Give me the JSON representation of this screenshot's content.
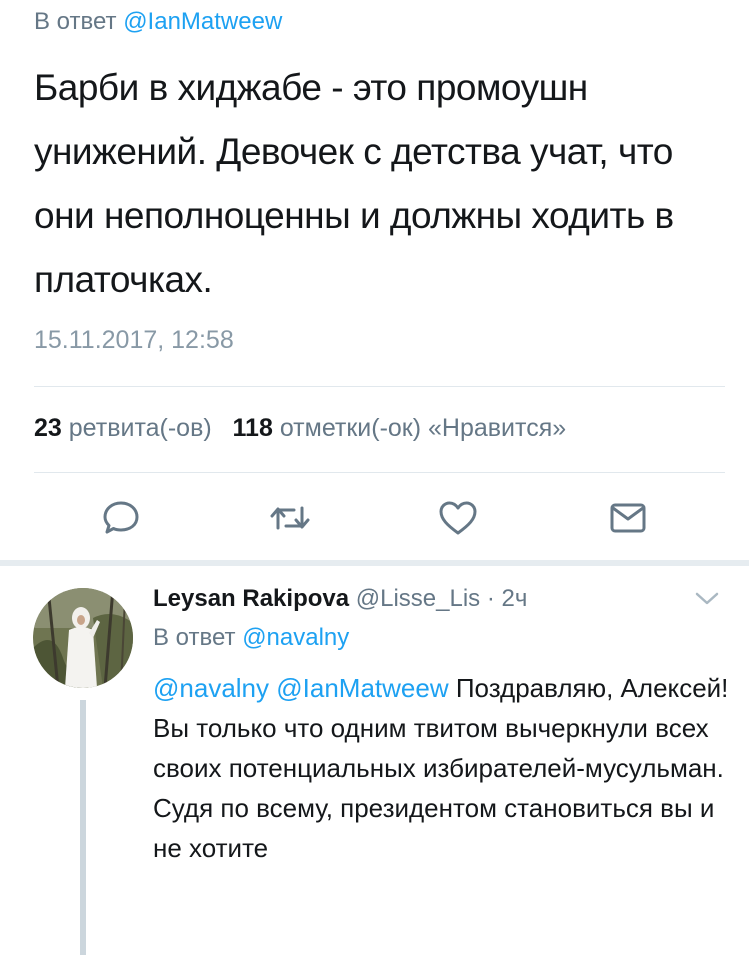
{
  "main_tweet": {
    "reply_prefix": "В ответ",
    "reply_handle": "@IanMatweew",
    "text": "Барби в хиджабе - это промоушн унижений. Девочек с детства учат, что они неполноценны и должны ходить в платочках.",
    "timestamp": "15.11.2017, 12:58",
    "retweet_count": "23",
    "retweet_label": "ретвита(-ов)",
    "like_count": "118",
    "like_label": "отметки(-ок) «Нравится»"
  },
  "actions": [
    {
      "name": "reply",
      "icon": "speech-bubble-icon"
    },
    {
      "name": "retweet",
      "icon": "retweet-icon"
    },
    {
      "name": "like",
      "icon": "heart-icon"
    },
    {
      "name": "message",
      "icon": "envelope-icon"
    }
  ],
  "reply": {
    "author_name": "Leysan Rakipova",
    "author_handle": "@Lisse_Lis",
    "separator": "·",
    "time": "2ч",
    "reply_prefix": "В ответ",
    "reply_handle": "@navalny",
    "mention_1": "@navalny",
    "mention_2": "@IanMatweew",
    "text": "Поздравляю, Алексей! Вы только что одним твитом вычеркнули всех своих потенциальных избирателей-мусульман. Судя по всему, президентом становиться вы и не хотите"
  },
  "colors": {
    "accent": "#1da1f2",
    "secondary_text": "#657786",
    "icon": "#657786",
    "divider": "#e1e8ed"
  }
}
